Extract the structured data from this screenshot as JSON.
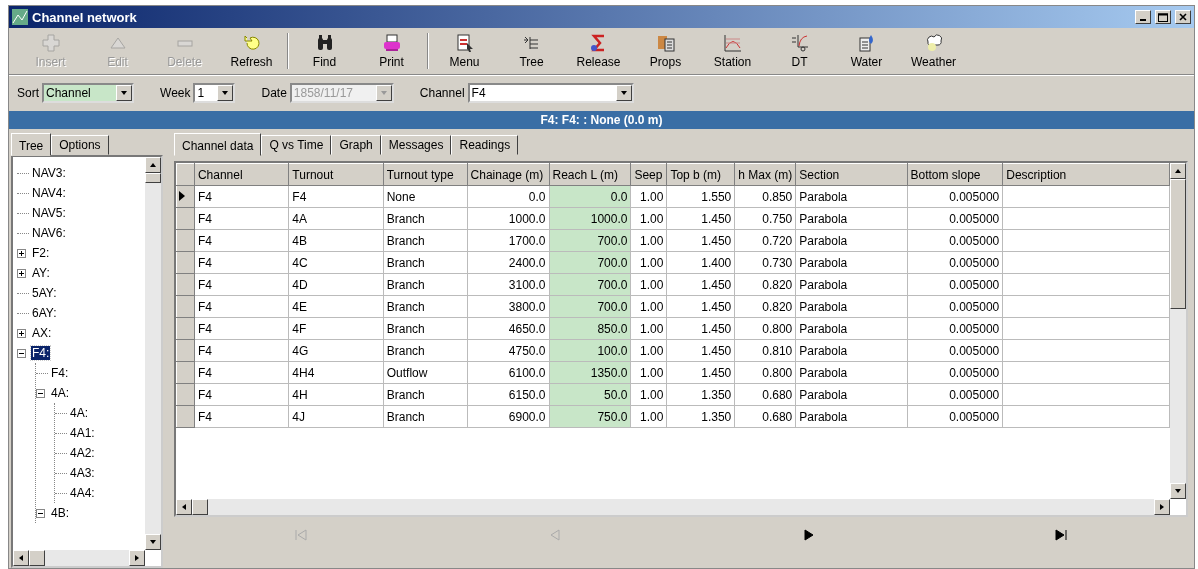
{
  "window": {
    "title": "Channel network"
  },
  "toolbar": [
    {
      "label": "Insert",
      "disabled": true
    },
    {
      "label": "Edit",
      "disabled": true
    },
    {
      "label": "Delete",
      "disabled": true
    },
    {
      "label": "Refresh",
      "disabled": false
    },
    {
      "label": "Find",
      "disabled": false
    },
    {
      "label": "Print",
      "disabled": false
    },
    {
      "label": "Menu",
      "disabled": false
    },
    {
      "label": "Tree",
      "disabled": false
    },
    {
      "label": "Release",
      "disabled": false
    },
    {
      "label": "Props",
      "disabled": false
    },
    {
      "label": "Station",
      "disabled": false
    },
    {
      "label": "DT",
      "disabled": false
    },
    {
      "label": "Water",
      "disabled": false
    },
    {
      "label": "Weather",
      "disabled": false
    }
  ],
  "filters": [
    {
      "label": "Sort",
      "value": "Channel",
      "kind": "sort",
      "disabled": false
    },
    {
      "label": "Week",
      "value": "1",
      "kind": "week",
      "disabled": false
    },
    {
      "label": "Date",
      "value": "1858/11/17",
      "kind": "date",
      "disabled": true
    },
    {
      "label": "Channel",
      "value": "F4",
      "kind": "channel",
      "disabled": false
    }
  ],
  "status_band": "F4: F4: : None (0.0 m)",
  "sidebar": {
    "tabs": [
      {
        "label": "Tree",
        "selected": true
      },
      {
        "label": "Options",
        "selected": false
      }
    ],
    "tree": [
      {
        "label": "NAV3:",
        "selected": false
      },
      {
        "label": "NAV4:",
        "selected": false
      },
      {
        "label": "NAV5:",
        "selected": false
      },
      {
        "label": "NAV6:",
        "selected": false
      },
      {
        "label": "F2:",
        "selected": false,
        "expanded": false
      },
      {
        "label": "AY:",
        "selected": false,
        "expanded": false
      },
      {
        "label": "5AY:",
        "selected": false
      },
      {
        "label": "6AY:",
        "selected": false
      },
      {
        "label": "AX:",
        "selected": false,
        "expanded": false
      },
      {
        "label": "F4:",
        "selected": true,
        "expanded": true,
        "children": [
          {
            "label": "F4:",
            "selected": false
          },
          {
            "label": "4A:",
            "selected": false,
            "expanded": true,
            "children": [
              {
                "label": "4A:",
                "selected": false
              },
              {
                "label": "4A1:",
                "selected": false
              },
              {
                "label": "4A2:",
                "selected": false
              },
              {
                "label": "4A3:",
                "selected": false
              },
              {
                "label": "4A4:",
                "selected": false
              }
            ]
          },
          {
            "label": "4B:",
            "selected": false,
            "expanded": true
          }
        ]
      }
    ]
  },
  "tabs": [
    {
      "label": "Channel data",
      "selected": true
    },
    {
      "label": "Q vs Time",
      "selected": false
    },
    {
      "label": "Graph",
      "selected": false
    },
    {
      "label": "Messages",
      "selected": false
    },
    {
      "label": "Readings",
      "selected": false
    }
  ],
  "table": {
    "columns": [
      {
        "label": "Channel",
        "kind": "text",
        "highlighted": false
      },
      {
        "label": "Turnout",
        "kind": "text",
        "highlighted": false
      },
      {
        "label": "Turnout type",
        "kind": "text",
        "highlighted": false
      },
      {
        "label": "Chainage (m)",
        "kind": "number",
        "highlighted": false
      },
      {
        "label": "Reach L (m)",
        "kind": "number",
        "highlighted": true
      },
      {
        "label": "Seep",
        "kind": "number",
        "highlighted": false
      },
      {
        "label": "Top b (m)",
        "kind": "number",
        "highlighted": false
      },
      {
        "label": "h Max (m)",
        "kind": "number",
        "highlighted": false
      },
      {
        "label": "Section",
        "kind": "text",
        "highlighted": false
      },
      {
        "label": "Bottom slope",
        "kind": "number",
        "highlighted": false
      },
      {
        "label": "Description",
        "kind": "text",
        "highlighted": false
      }
    ],
    "rows": [
      {
        "selected": true,
        "cells": [
          "F4",
          "F4",
          "None",
          "0.0",
          "0.0",
          "1.00",
          "1.550",
          "0.850",
          "Parabola",
          "0.005000",
          ""
        ]
      },
      {
        "selected": false,
        "cells": [
          "F4",
          "4A",
          "Branch",
          "1000.0",
          "1000.0",
          "1.00",
          "1.450",
          "0.750",
          "Parabola",
          "0.005000",
          ""
        ]
      },
      {
        "selected": false,
        "cells": [
          "F4",
          "4B",
          "Branch",
          "1700.0",
          "700.0",
          "1.00",
          "1.450",
          "0.720",
          "Parabola",
          "0.005000",
          ""
        ]
      },
      {
        "selected": false,
        "cells": [
          "F4",
          "4C",
          "Branch",
          "2400.0",
          "700.0",
          "1.00",
          "1.400",
          "0.730",
          "Parabola",
          "0.005000",
          ""
        ]
      },
      {
        "selected": false,
        "cells": [
          "F4",
          "4D",
          "Branch",
          "3100.0",
          "700.0",
          "1.00",
          "1.450",
          "0.820",
          "Parabola",
          "0.005000",
          ""
        ]
      },
      {
        "selected": false,
        "cells": [
          "F4",
          "4E",
          "Branch",
          "3800.0",
          "700.0",
          "1.00",
          "1.450",
          "0.820",
          "Parabola",
          "0.005000",
          ""
        ]
      },
      {
        "selected": false,
        "cells": [
          "F4",
          "4F",
          "Branch",
          "4650.0",
          "850.0",
          "1.00",
          "1.450",
          "0.800",
          "Parabola",
          "0.005000",
          ""
        ]
      },
      {
        "selected": false,
        "cells": [
          "F4",
          "4G",
          "Branch",
          "4750.0",
          "100.0",
          "1.00",
          "1.450",
          "0.810",
          "Parabola",
          "0.005000",
          ""
        ]
      },
      {
        "selected": false,
        "cells": [
          "F4",
          "4H4",
          "Outflow",
          "6100.0",
          "1350.0",
          "1.00",
          "1.450",
          "0.800",
          "Parabola",
          "0.005000",
          ""
        ]
      },
      {
        "selected": false,
        "cells": [
          "F4",
          "4H",
          "Branch",
          "6150.0",
          "50.0",
          "1.00",
          "1.350",
          "0.680",
          "Parabola",
          "0.005000",
          ""
        ]
      },
      {
        "selected": false,
        "cells": [
          "F4",
          "4J",
          "Branch",
          "6900.0",
          "750.0",
          "1.00",
          "1.350",
          "0.680",
          "Parabola",
          "0.005000",
          ""
        ]
      }
    ]
  },
  "navigator": [
    {
      "kind": "first",
      "disabled": true
    },
    {
      "kind": "prior",
      "disabled": true
    },
    {
      "kind": "next",
      "disabled": false
    },
    {
      "kind": "last",
      "disabled": false
    }
  ]
}
